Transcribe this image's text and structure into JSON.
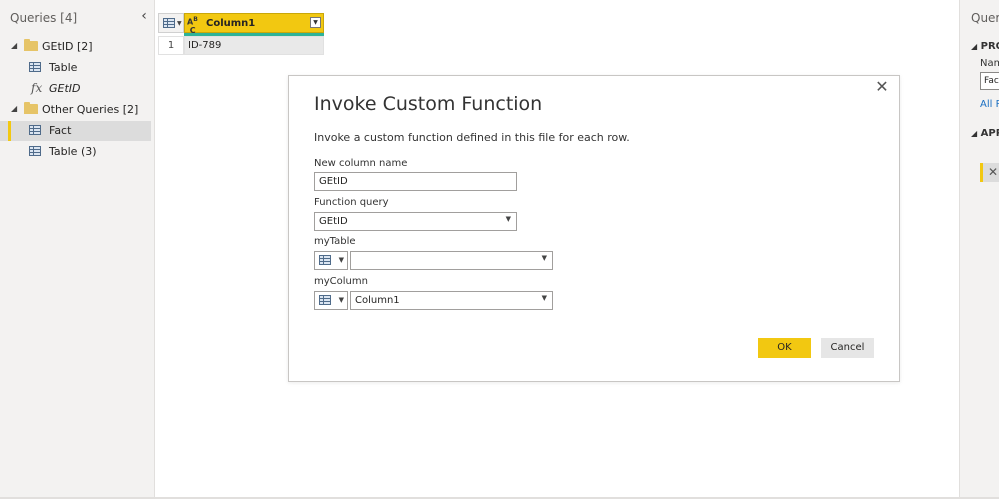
{
  "left_pane": {
    "title": "Queries [4]",
    "groups": [
      {
        "label": "GEtID [2]",
        "items": [
          {
            "label": "Table",
            "icon": "table-icon"
          },
          {
            "label": "GEtID",
            "icon": "fx-icon"
          }
        ]
      },
      {
        "label": "Other Queries [2]",
        "items": [
          {
            "label": "Fact",
            "icon": "table-icon",
            "selected": true
          },
          {
            "label": "Table (3)",
            "icon": "table-icon"
          }
        ]
      }
    ]
  },
  "grid": {
    "column_header": "Column1",
    "rows": [
      {
        "row_number": "1",
        "value": "ID-789"
      }
    ]
  },
  "right_pane": {
    "title": "Query",
    "properties_section": "PRO",
    "name_label": "Nam",
    "name_value": "Fac",
    "all_properties_link": "All P",
    "applied_steps_section": "APP",
    "step_delete_glyph": "✕"
  },
  "dialog": {
    "title": "Invoke Custom Function",
    "description": "Invoke a custom function defined in this file for each row.",
    "new_column_name_label": "New column name",
    "new_column_name_value": "GEtID",
    "function_query_label": "Function query",
    "function_query_value": "GEtID",
    "my_table_label": "myTable",
    "my_table_value": "",
    "my_column_label": "myColumn",
    "my_column_value": "Column1",
    "ok_label": "OK",
    "cancel_label": "Cancel",
    "close_glyph": "✕"
  },
  "colors": {
    "accent_yellow": "#f2c811",
    "header_underline": "#2eb398",
    "link_blue": "#1a6fc2"
  }
}
